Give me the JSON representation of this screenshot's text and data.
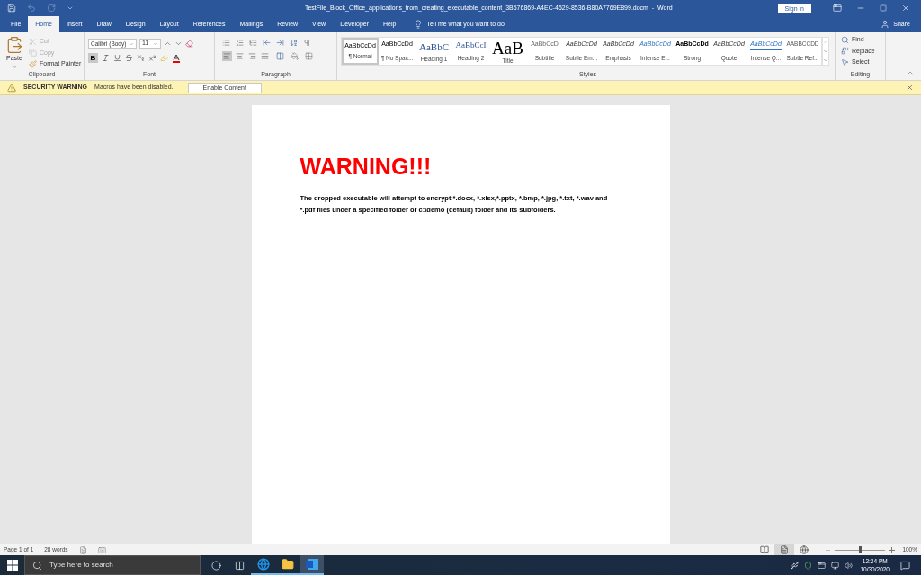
{
  "title_bar": {
    "title": "TestFile_Block_Office_applications_from_creating_executable_content_3B576869-A4EC-4529-8536-B80A7769E899.docm  -  Word",
    "sign_in": "Sign in"
  },
  "tabs": [
    {
      "label": "File",
      "selected": false
    },
    {
      "label": "Home",
      "selected": true
    },
    {
      "label": "Insert",
      "selected": false
    },
    {
      "label": "Draw",
      "selected": false
    },
    {
      "label": "Design",
      "selected": false
    },
    {
      "label": "Layout",
      "selected": false
    },
    {
      "label": "References",
      "selected": false
    },
    {
      "label": "Mailings",
      "selected": false
    },
    {
      "label": "Review",
      "selected": false
    },
    {
      "label": "View",
      "selected": false
    },
    {
      "label": "Developer",
      "selected": false
    },
    {
      "label": "Help",
      "selected": false
    }
  ],
  "tell_me": "Tell me what you want to do",
  "share": "Share",
  "clipboard": {
    "paste": "Paste",
    "items": [
      {
        "kind": "cut",
        "label": "Cut",
        "disabled": true
      },
      {
        "kind": "copy",
        "label": "Copy",
        "disabled": true
      },
      {
        "kind": "painter",
        "label": "Format Painter",
        "disabled": false
      }
    ],
    "label": "Clipboard"
  },
  "font": {
    "family": "Calibri (Body)",
    "size": "11",
    "label": "Font",
    "bold_label": "B",
    "bold_selected": true
  },
  "paragraph": {
    "label": "Paragraph",
    "align": [
      {
        "kind": "left",
        "selected": true
      },
      {
        "kind": "center",
        "selected": false
      },
      {
        "kind": "right",
        "selected": false
      },
      {
        "kind": "justify",
        "selected": false
      }
    ]
  },
  "styles": {
    "label": "Styles",
    "items": [
      {
        "kind": "normal",
        "sample": "AaBbCcDd",
        "name": "¶ Normal",
        "selected": true
      },
      {
        "kind": "normal",
        "sample": "AaBbCcDd",
        "name": "¶ No Spac...",
        "selected": false
      },
      {
        "kind": "heading1",
        "sample": "AaBbC",
        "name": "Heading 1",
        "selected": false
      },
      {
        "kind": "heading2",
        "sample": "AaBbCcI",
        "name": "Heading 2",
        "selected": false
      },
      {
        "kind": "title",
        "sample": "AaB",
        "name": "Title",
        "selected": false
      },
      {
        "kind": "subtitle",
        "sample": "AaBbCcD",
        "name": "Subtitle",
        "selected": false
      },
      {
        "kind": "italic",
        "sample": "AaBbCcDd",
        "name": "Subtle Em...",
        "selected": false
      },
      {
        "kind": "italic",
        "sample": "AaBbCcDd",
        "name": "Emphasis",
        "selected": false
      },
      {
        "kind": "intense",
        "sample": "AaBbCcDd",
        "name": "Intense E...",
        "selected": false
      },
      {
        "kind": "strong",
        "sample": "AaBbCcDd",
        "name": "Strong",
        "selected": false
      },
      {
        "kind": "italic",
        "sample": "AaBbCcDd",
        "name": "Quote",
        "selected": false
      },
      {
        "kind": "intensequote",
        "sample": "AaBbCcDd",
        "name": "Intense Q...",
        "selected": false
      },
      {
        "kind": "reference",
        "sample": "AABBCCDD",
        "name": "Subtle Ref...",
        "selected": false
      }
    ]
  },
  "editing": {
    "label": "Editing",
    "items": [
      {
        "kind": "find",
        "label": "Find"
      },
      {
        "kind": "replace",
        "label": "Replace"
      },
      {
        "kind": "select",
        "label": "Select"
      }
    ]
  },
  "security_bar": {
    "title": "SECURITY WARNING",
    "message": "Macros have been disabled.",
    "button": "Enable Content"
  },
  "document": {
    "heading": "WARNING!!!",
    "paragraph": "The dropped executable will attempt to encrypt *.docx, *.xlsx,*.pptx, *.bmp, *.jpg, *.txt, *.wav and *.pdf files under a specified folder or c:\\demo (default) folder and its subfolders."
  },
  "status_bar": {
    "page": "Page 1 of 1",
    "words": "28 words",
    "views": [
      {
        "kind": "read",
        "selected": false
      },
      {
        "kind": "print",
        "selected": true
      },
      {
        "kind": "web",
        "selected": false
      }
    ],
    "level": 0.5,
    "zoom": "100%"
  },
  "taskbar": {
    "search_placeholder": "Type here to search",
    "apps": [
      {
        "kind": "edge",
        "selected": false
      },
      {
        "kind": "explorer",
        "selected": false
      },
      {
        "kind": "word",
        "selected": true
      }
    ],
    "time": "12:24 PM",
    "date": "10/30/2020"
  }
}
